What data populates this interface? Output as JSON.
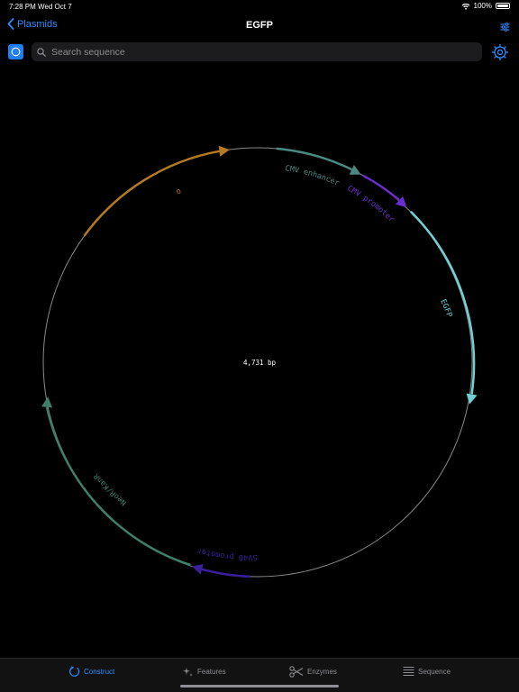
{
  "status": {
    "time": "7:28 PM",
    "date": "Wed Oct 7",
    "battery": "100%"
  },
  "nav": {
    "back_label": "Plasmids",
    "title": "EGFP"
  },
  "search": {
    "placeholder": "Search sequence",
    "value": ""
  },
  "map": {
    "center_label": "4,731 bp",
    "feature_labels": {
      "ori": "ori",
      "cmv_enhancer": "CMV enhancer",
      "cmv_promoter": "CMV promoter",
      "egfp": "EGFP",
      "sv40_promoter": "SV40 promoter",
      "neo_kan": "NeoR/KanR"
    },
    "colors": {
      "backbone": "#8a8a8a",
      "ori": "#b57b1f",
      "cmv_enhancer": "#4a8a80",
      "cmv_promoter": "#6a2dd0",
      "egfp": "#6fd0d6",
      "sv40_promoter": "#3a1f9a",
      "neo_kan": "#3f7f6a"
    }
  },
  "tabs": [
    {
      "label": "Construct",
      "icon": "circle-arrow-icon",
      "active": true
    },
    {
      "label": "Features",
      "icon": "sparkles-icon",
      "active": false
    },
    {
      "label": "Enzymes",
      "icon": "scissors-icon",
      "active": false
    },
    {
      "label": "Sequence",
      "icon": "lines-icon",
      "active": false
    }
  ],
  "colors": {
    "accent": "#2f8cff",
    "background": "#000000"
  }
}
